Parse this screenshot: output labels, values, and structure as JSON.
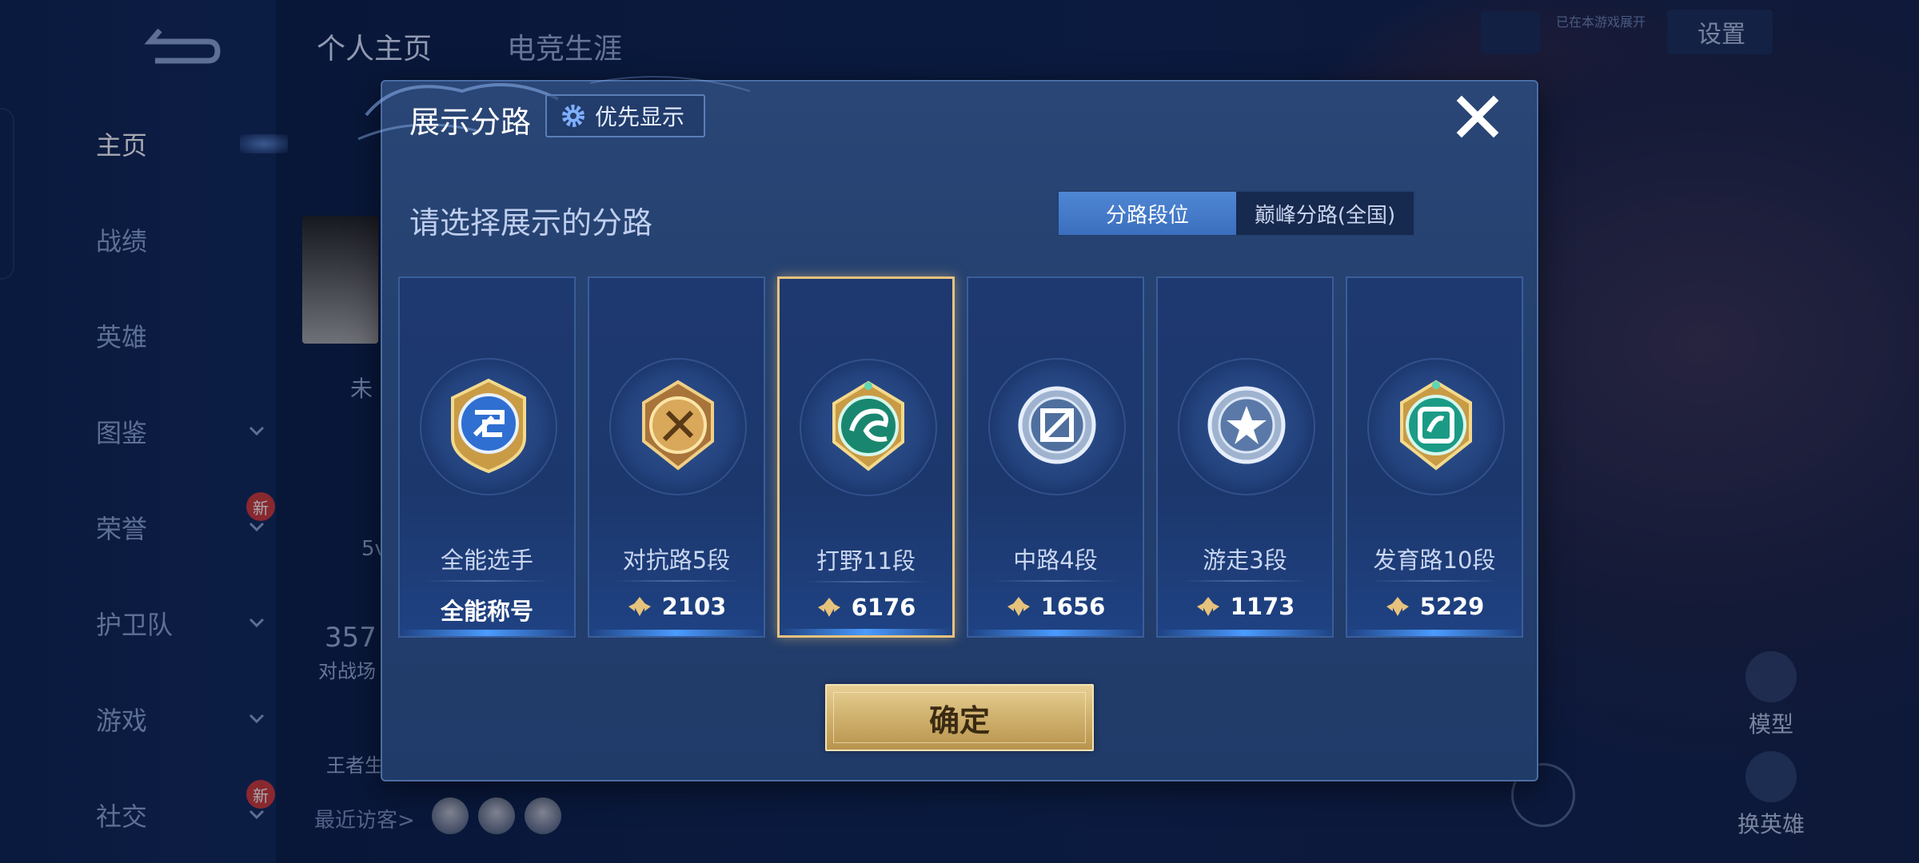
{
  "sidebar": {
    "items": [
      {
        "label": "主页"
      },
      {
        "label": "战绩"
      },
      {
        "label": "英雄"
      },
      {
        "label": "图鉴"
      },
      {
        "label": "荣誉",
        "badge": "新"
      },
      {
        "label": "护卫队"
      },
      {
        "label": "游戏"
      },
      {
        "label": "社交",
        "badge": "新"
      }
    ]
  },
  "top_tabs": [
    "个人主页",
    "电竞生涯"
  ],
  "top_right": {
    "settings_label": "设置",
    "small_note": "已在本游戏展开"
  },
  "background": {
    "profile_partial": "未",
    "partial_num_1": "5v",
    "partial_num_2": "357",
    "partial_label_2": "对战场",
    "partial_label_3": "王者生",
    "visitor_label": "最近访客>",
    "right_btn_model": "模型",
    "right_btn_hero": "换英雄"
  },
  "dialog": {
    "title": "展示分路",
    "pref_button_label": "优先显示",
    "subtitle": "请选择展示的分路",
    "segments": [
      {
        "label": "分路段位",
        "active": true
      },
      {
        "label": "巅峰分路(全国)",
        "active": false
      }
    ],
    "cards": [
      {
        "name": "全能选手",
        "score": "全能称号",
        "badge": "allround-badge-icon",
        "selected": false
      },
      {
        "name": "对抗路5段",
        "score": "2103",
        "badge": "clash-lane-badge-icon",
        "selected": false
      },
      {
        "name": "打野11段",
        "score": "6176",
        "badge": "jungle-badge-icon",
        "selected": true
      },
      {
        "name": "中路4段",
        "score": "1656",
        "badge": "mid-lane-badge-icon",
        "selected": false
      },
      {
        "name": "游走3段",
        "score": "1173",
        "badge": "roam-badge-icon",
        "selected": false
      },
      {
        "name": "发育路10段",
        "score": "5229",
        "badge": "farm-lane-badge-icon",
        "selected": false
      }
    ],
    "confirm_label": "确定"
  },
  "colors": {
    "accent_gold": "#e7c27c",
    "segment_active": "#4f87d4",
    "dialog_bg": "#24406f"
  }
}
